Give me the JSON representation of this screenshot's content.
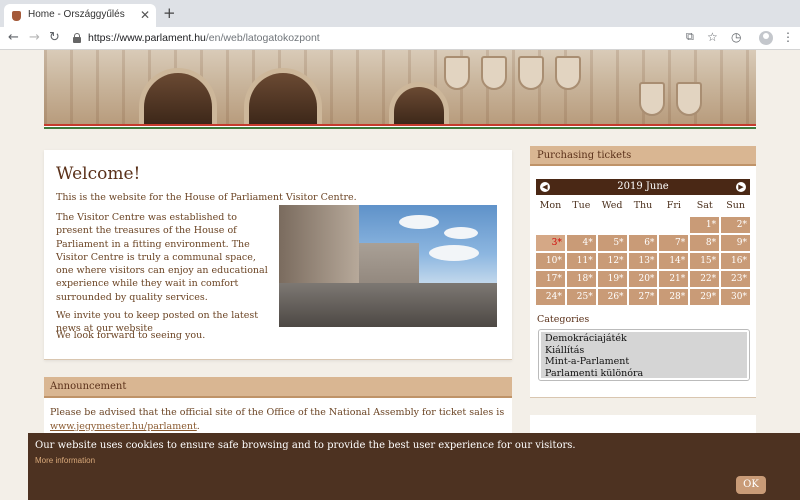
{
  "browser": {
    "tab_title": "Home - Országgyűlés",
    "close_glyph": "✕",
    "new_tab_glyph": "+",
    "url_domain": "https://www.parlament.hu",
    "url_path": "/en/web/latogatokozpont",
    "icons": [
      "back-arrow-icon",
      "forward-arrow-icon",
      "reload-icon",
      "lock-icon",
      "translate-icon",
      "star-icon",
      "extension-icon",
      "profile-icon",
      "menu-icon"
    ]
  },
  "welcome": {
    "title": "Welcome!",
    "intro": "This is the website for the House of Parliament Visitor Centre.",
    "para1": "The Visitor Centre was established to present the treasures of the House of Parliament in a fitting environment. The Visitor Centre is truly a communal space, one where visitors can enjoy an educational experience while they wait in comfort surrounded by quality services.",
    "para2": "We invite you to keep posted on the latest news at our website",
    "closing": "We look forward to seeing you."
  },
  "announcement": {
    "heading": "Announcement",
    "text": "Please be advised that the official site of the Office of the National Assembly for ticket sales is",
    "link": "www.jegymester.hu/parlament",
    "link_suffix": "."
  },
  "sidebar": {
    "heading": "Purchasing tickets",
    "calendar": {
      "title": "2019 June",
      "prev_glyph": "◀",
      "next_glyph": "▶",
      "weekdays": [
        "Mon",
        "Tue",
        "Wed",
        "Thu",
        "Fri",
        "Sat",
        "Sun"
      ],
      "days": [
        "",
        "",
        "",
        "",
        "",
        "1*",
        "2*",
        "3*",
        "4*",
        "5*",
        "6*",
        "7*",
        "8*",
        "9*",
        "10*",
        "11*",
        "12*",
        "13*",
        "14*",
        "15*",
        "16*",
        "17*",
        "18*",
        "19*",
        "20*",
        "21*",
        "22*",
        "23*",
        "24*",
        "25*",
        "26*",
        "27*",
        "28*",
        "29*",
        "30*"
      ],
      "today": "3*"
    },
    "categories_label": "Categories",
    "categories": [
      "Demokráciajáték",
      "Kiállítás",
      "Mint-a-Parlament",
      "Parlamenti különóra"
    ]
  },
  "cookie": {
    "text": "Our website uses cookies to ensure safe browsing and to provide the best user experience for our visitors.",
    "more": "More information",
    "ok": "OK"
  },
  "colors": {
    "panel_head": "#d9b692",
    "calendar_header": "#4a2815",
    "day_cell": "#c99b77",
    "cookie_bar": "#4d3221",
    "flag_red": "#c53a2d",
    "flag_green": "#3f7a3d"
  }
}
